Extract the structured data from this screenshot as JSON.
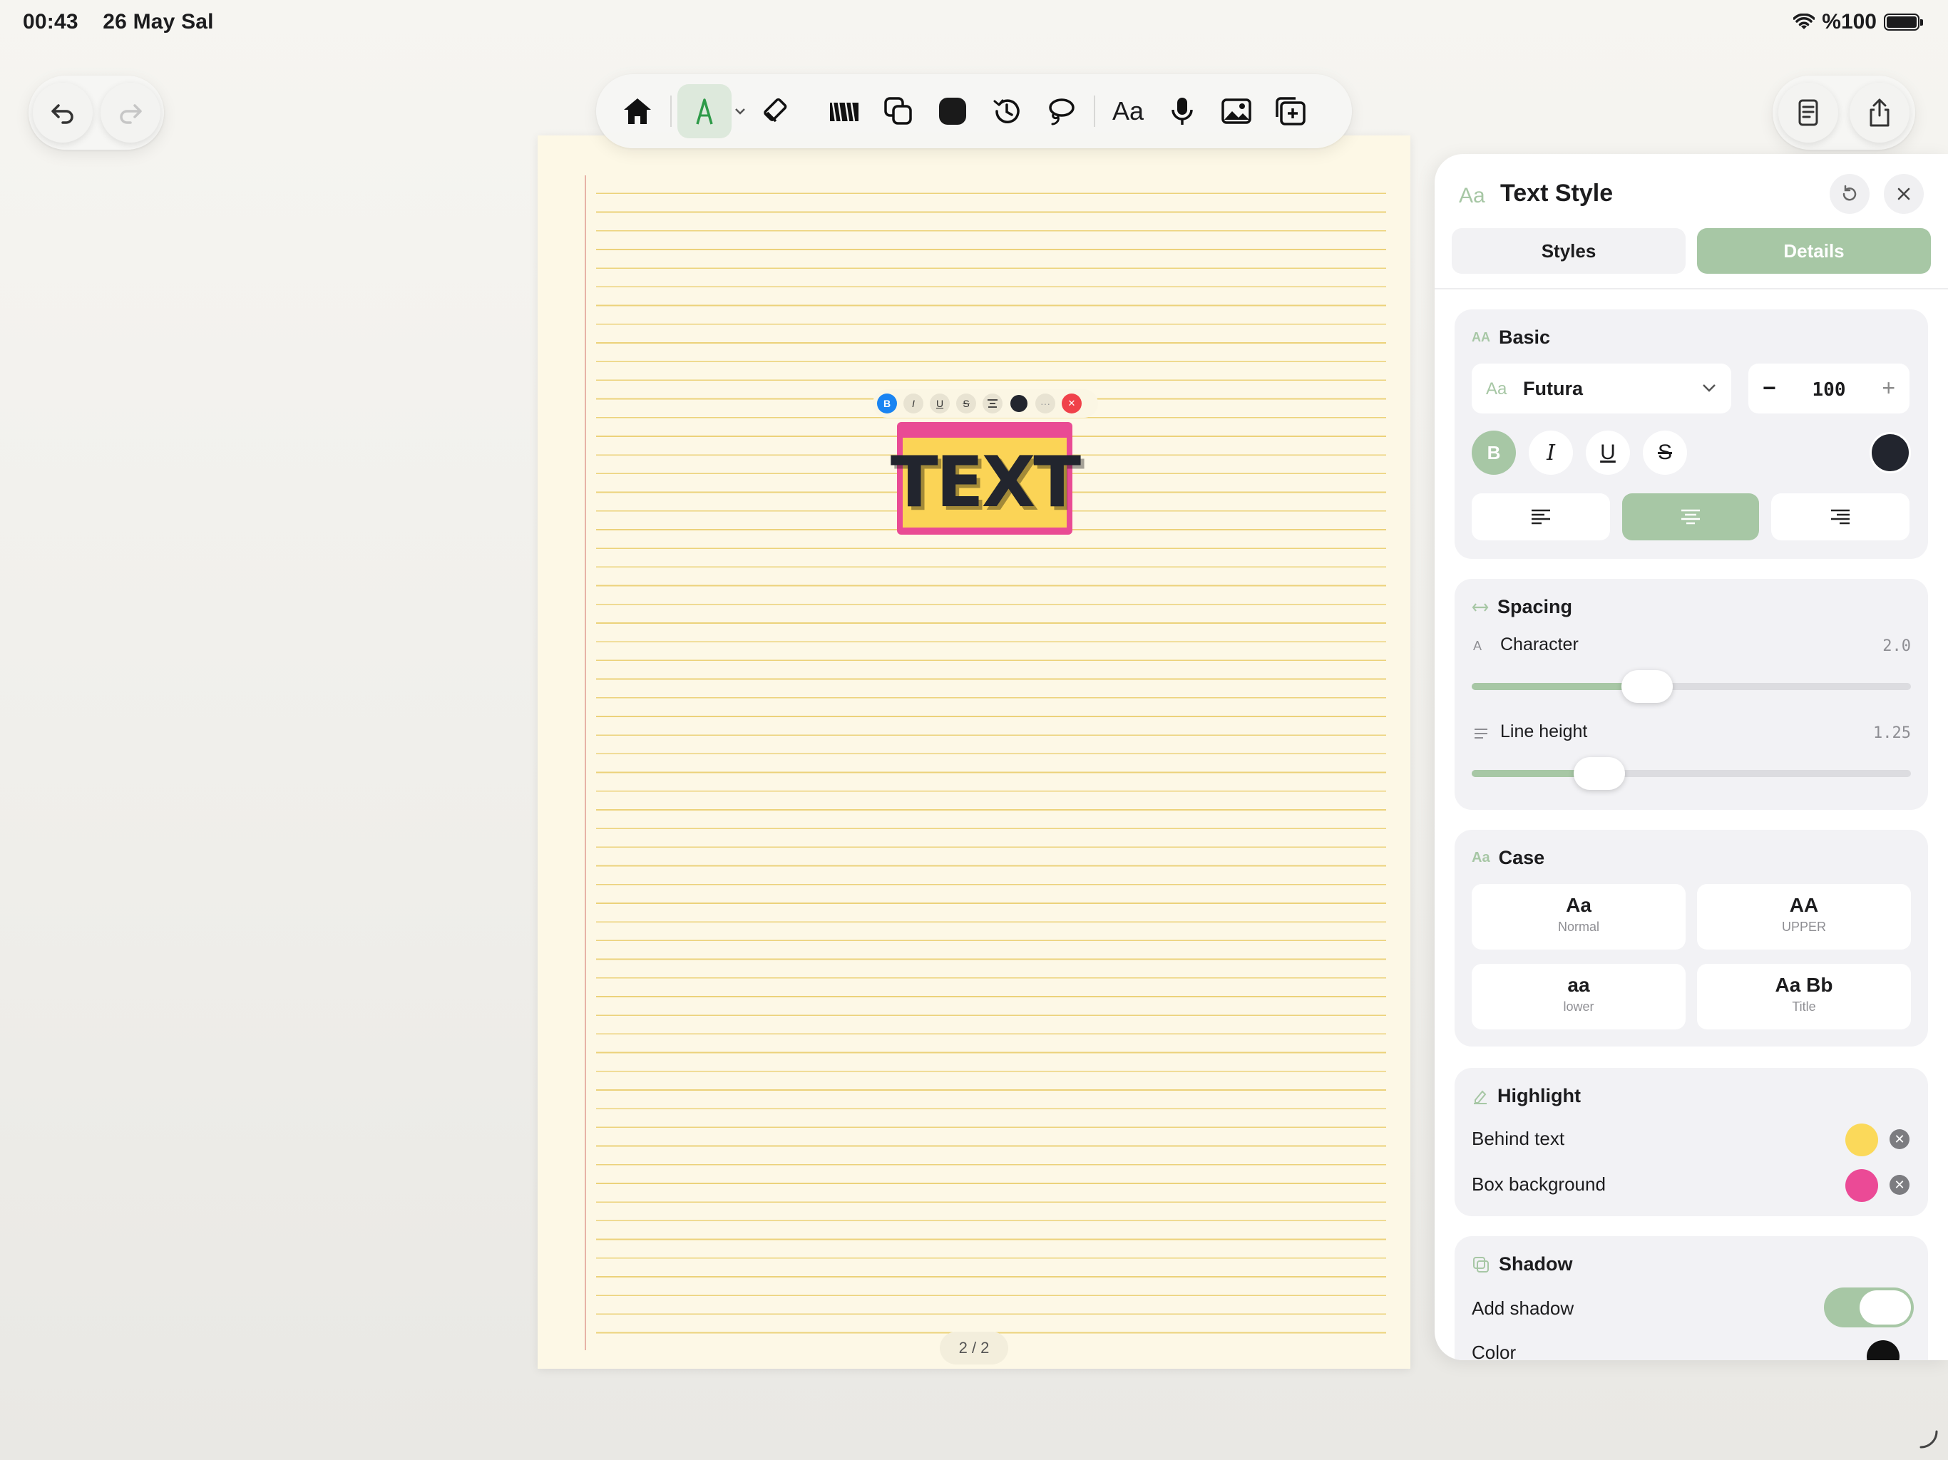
{
  "status_bar": {
    "time": "00:43",
    "date": "26 May Sal",
    "battery": "%100"
  },
  "toolbar": {
    "tools": [
      "home-icon",
      "pen-icon",
      "chevron-down-icon",
      "eraser-icon",
      "highlighter-icon",
      "shapes-icon",
      "color-icon",
      "history-icon",
      "lasso-icon",
      "text-icon",
      "microphone-icon",
      "image-icon",
      "add-page-icon"
    ],
    "text_tool_label": "Aa"
  },
  "canvas": {
    "text_box": {
      "text": "TEXT",
      "highlight_color": "#fbd456",
      "box_color": "#e94b94",
      "text_color": "#22252e"
    },
    "format_bar": {
      "bold": "B",
      "italic": "I",
      "underline": "U",
      "strike": "S",
      "more": "···",
      "close": "✕"
    },
    "page_indicator": "2 / 2"
  },
  "panel": {
    "title_icon": "Aa",
    "title": "Text Style",
    "tabs": [
      {
        "label": "Styles",
        "active": false
      },
      {
        "label": "Details",
        "active": true
      }
    ],
    "basic": {
      "icon": "AA",
      "title": "Basic",
      "font_icon": "Aa",
      "font": "Futura",
      "size": "100",
      "minus": "−",
      "plus": "+",
      "bold": "B",
      "italic": "I",
      "underline": "U",
      "strike": "S",
      "text_color": "#22252e",
      "alignment": "center"
    },
    "spacing": {
      "title": "Spacing",
      "character_icon": "A",
      "character_label": "Character",
      "character_value": "2.0",
      "character_level": 0.4,
      "line_label": "Line height",
      "line_value": "1.25",
      "line_level": 0.29
    },
    "case": {
      "icon": "Aa",
      "title": "Case",
      "options": [
        {
          "big": "Aa",
          "small": "Normal"
        },
        {
          "big": "AA",
          "small": "UPPER"
        },
        {
          "big": "aa",
          "small": "lower"
        },
        {
          "big": "Aa Bb",
          "small": "Title"
        }
      ]
    },
    "highlight": {
      "title": "Highlight",
      "behind_label": "Behind text",
      "behind_color": "#fbd95a",
      "box_label": "Box background",
      "box_color": "#eb4a96"
    },
    "shadow": {
      "title": "Shadow",
      "add_label": "Add shadow",
      "enabled": true,
      "color_label": "Color"
    }
  },
  "accent": "#a7c7a5"
}
